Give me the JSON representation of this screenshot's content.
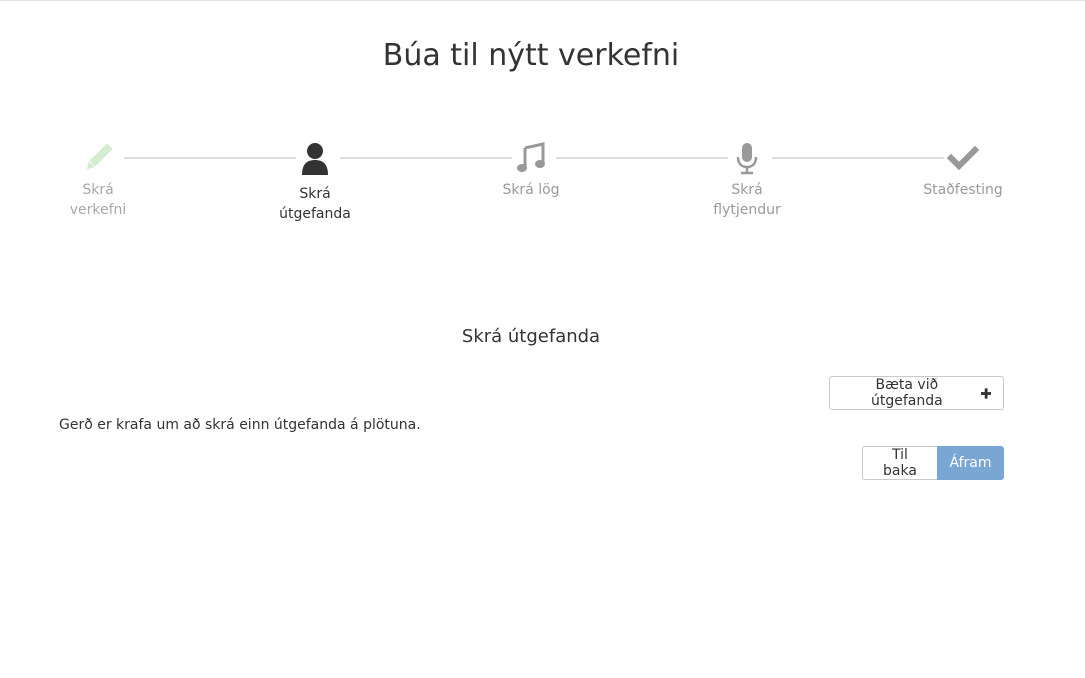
{
  "page": {
    "title": "Búa til nýtt verkefni"
  },
  "wizard": {
    "steps": [
      {
        "lines": [
          "Skrá",
          "verkefni"
        ],
        "icon": "pencil-icon",
        "state": "done"
      },
      {
        "lines": [
          "Skrá",
          "útgefanda"
        ],
        "icon": "user-icon",
        "state": "active"
      },
      {
        "lines": [
          "Skrá lög"
        ],
        "icon": "music-icon",
        "state": "pending"
      },
      {
        "lines": [
          "Skrá",
          "flytjendur"
        ],
        "icon": "microphone-icon",
        "state": "pending"
      },
      {
        "lines": [
          "Staðfesting"
        ],
        "icon": "check-icon",
        "state": "pending"
      }
    ]
  },
  "section": {
    "title": "Skrá útgefanda",
    "add_button_label": "Bæta við útgefanda",
    "info_text": "Gerð er krafa um að skrá einn útgefanda á plötuna."
  },
  "nav": {
    "back_label": "Til baka",
    "next_label": "Áfram"
  },
  "colors": {
    "done": "#d4ecd1",
    "active": "#333333",
    "pending": "#999999",
    "primary": "#7aa6d4",
    "connector": "#dedede"
  }
}
